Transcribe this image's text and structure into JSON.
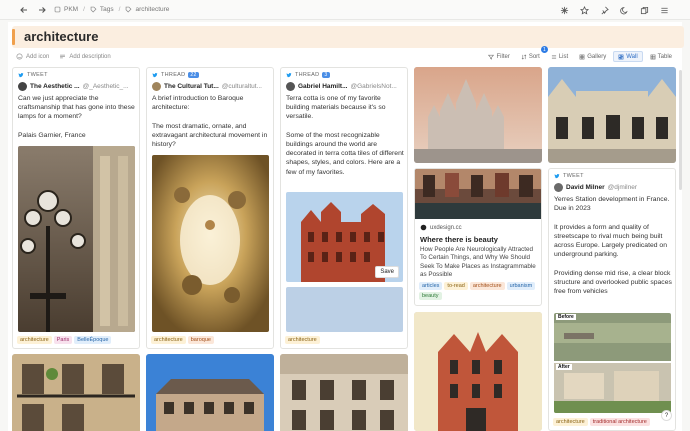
{
  "breadcrumb": {
    "home": "PKM",
    "tags": "Tags",
    "current": "architecture"
  },
  "page": {
    "title": "architecture",
    "add_icon": "Add icon",
    "add_description": "Add description"
  },
  "views": {
    "filter": "Filter",
    "sort": "Sort",
    "sort_count": "1",
    "list": "List",
    "gallery": "Gallery",
    "wall": "Wall",
    "table": "Table"
  },
  "cards": {
    "c1": {
      "type": "TWEET",
      "author": "The Aesthetic ...",
      "handle": "@_Aesthetic_...",
      "text": "Can we just appreciate the craftsmanship that has gone into these lamps for a moment?\n\nPalais Garnier, France",
      "tags": [
        "architecture",
        "Paris",
        "BelleÉpoque"
      ]
    },
    "c2": {
      "type": "THREAD",
      "count": "22",
      "author": "The Cultural Tut...",
      "handle": "@culturaltut...",
      "text": "A brief introduction to Baroque architecture:\n\nThe most dramatic, ornate, and extravagant architectural movement in history?",
      "tags": [
        "architecture",
        "baroque"
      ]
    },
    "c3": {
      "type": "THREAD",
      "count": "3",
      "author": "Gabriel Hamilt...",
      "handle": "@GabrielsNot...",
      "text": "Terra cotta is one of my favorite building materials because it's so versatile.\n\nSome of the most recognizable buildings around the world are decorated in terra cotta tiles of different shapes, styles, and colors. Here are a few of my favorites.",
      "save": "Save",
      "tags": [
        "architecture"
      ]
    },
    "c4": {
      "site": "uxdesign.cc",
      "title": "Where there is beauty",
      "text": "How People Are Neurologically Attracted To Certain Things, and Why We Should Seek To Make Places as Instagrammable as Possible",
      "tags": [
        "articles",
        "to-read",
        "architecture",
        "urbanism",
        "beauty"
      ]
    },
    "c5": {
      "type": "TWEET",
      "author": "David Milner",
      "handle": "@djmilner",
      "text": "Yerres Station development in France. Due in 2023\n\nIt provides a form and quality of streetscape to rival much being built across Europe. Largely predicated on underground parking.\n\nProviding dense mid rise, a clear block structure and overlooked public spaces free from vehicles",
      "before": "Before",
      "after": "After",
      "tags": [
        "architecture",
        "traditional architecture"
      ]
    }
  },
  "help": "?"
}
